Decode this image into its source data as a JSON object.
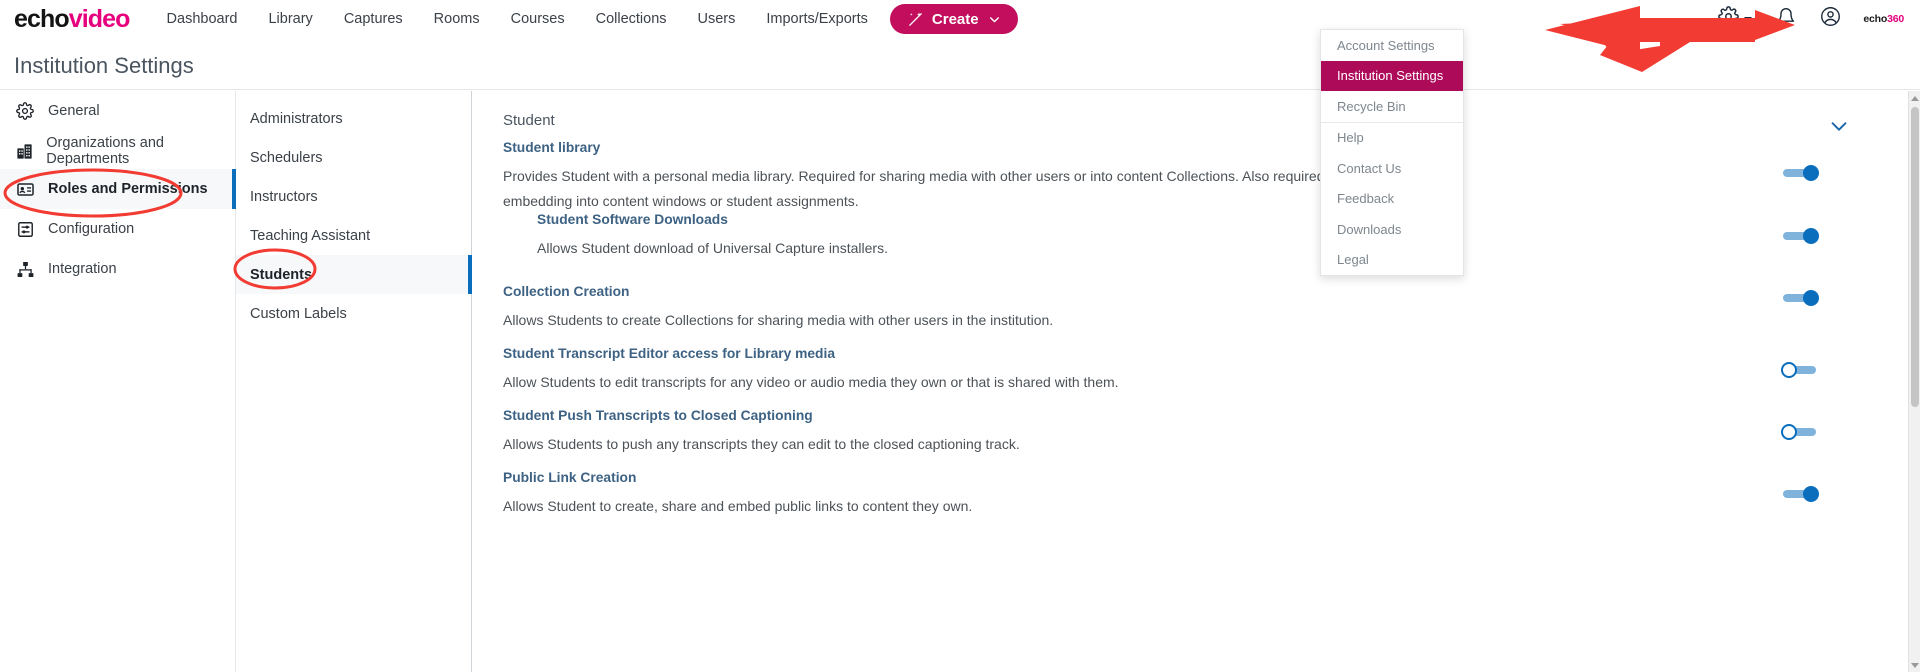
{
  "brand": {
    "part1": "echo",
    "part2": "video"
  },
  "topnav": {
    "links": [
      {
        "label": "Dashboard"
      },
      {
        "label": "Library"
      },
      {
        "label": "Captures"
      },
      {
        "label": "Rooms"
      },
      {
        "label": "Courses"
      },
      {
        "label": "Collections"
      },
      {
        "label": "Users"
      },
      {
        "label": "Imports/Exports"
      }
    ],
    "create_label": "Create",
    "create_color": "#c20e5c",
    "icons": {
      "wand": "magic-wand-icon",
      "chevron": "chevron-down-icon",
      "gear": "gear-icon",
      "bell": "bell-icon",
      "avatar": "user-avatar-icon"
    },
    "corner_logo": {
      "part1": "echo",
      "part2": "360"
    }
  },
  "header": {
    "title": "Institution Settings"
  },
  "sidebar": {
    "items": [
      {
        "label": "General",
        "icon": "gear-icon",
        "active": false
      },
      {
        "label": "Organizations and Departments",
        "icon": "building-icon",
        "active": false
      },
      {
        "label": "Roles and Permissions",
        "icon": "id-card-icon",
        "active": true
      },
      {
        "label": "Configuration",
        "icon": "sliders-icon",
        "active": false
      },
      {
        "label": "Integration",
        "icon": "sitemap-icon",
        "active": false
      }
    ]
  },
  "rolelist": {
    "items": [
      {
        "label": "Administrators",
        "active": false
      },
      {
        "label": "Schedulers",
        "active": false
      },
      {
        "label": "Instructors",
        "active": false
      },
      {
        "label": "Teaching Assistant",
        "active": false
      },
      {
        "label": "Students",
        "active": true
      },
      {
        "label": "Custom Labels",
        "active": false
      }
    ]
  },
  "main": {
    "section_title": "Student",
    "collapse_icon": "chevron-down-icon",
    "permissions": [
      {
        "title": "Student library",
        "description": "Provides Student with a personal media library. Required for sharing media with other users or into content Collections. Also required for student\nembedding into content windows or student assignments.",
        "toggle": "on",
        "indent": false
      },
      {
        "title": "Student Software Downloads",
        "description": "Allows Student download of Universal Capture installers.",
        "toggle": "on",
        "indent": true
      },
      {
        "title": "Collection Creation",
        "description": "Allows Students to create Collections for sharing media with other users in the institution.",
        "toggle": "on",
        "indent": false
      },
      {
        "title": "Student Transcript Editor access for Library media",
        "description": "Allow Students to edit transcripts for any video or audio media they own or that is shared with them.",
        "toggle": "off",
        "indent": false
      },
      {
        "title": "Student Push Transcripts to Closed Captioning",
        "description": "Allows Students to push any transcripts they can edit to the closed captioning track.",
        "toggle": "off",
        "indent": false
      },
      {
        "title": "Public Link Creation",
        "description": "Allows Student to create, share and embed public links to content they own.",
        "toggle": "on",
        "indent": false
      }
    ]
  },
  "settings_menu": {
    "items": [
      {
        "label": "Account Settings",
        "highlight": false,
        "separator_after": false
      },
      {
        "label": "Institution Settings",
        "highlight": true,
        "separator_after": false
      },
      {
        "label": "Recycle Bin",
        "highlight": false,
        "separator_after": true
      },
      {
        "label": "Help",
        "highlight": false,
        "separator_after": false
      },
      {
        "label": "Contact Us",
        "highlight": false,
        "separator_after": false
      },
      {
        "label": "Feedback",
        "highlight": false,
        "separator_after": false
      },
      {
        "label": "Downloads",
        "highlight": false,
        "separator_after": false
      },
      {
        "label": "Legal",
        "highlight": false,
        "separator_after": false
      }
    ],
    "highlight_color": "#ad0b5a"
  },
  "annotations": {
    "arrow_color": "#f23b32",
    "ellipse_color": "#f23b32"
  }
}
